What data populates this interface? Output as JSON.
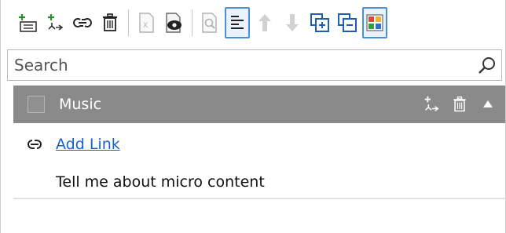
{
  "toolbar": {
    "buttons": [
      {
        "name": "add-item-button",
        "icon": "add-item-icon"
      },
      {
        "name": "add-category-button",
        "icon": "add-category-icon"
      },
      {
        "name": "link-button",
        "icon": "link-icon"
      },
      {
        "name": "delete-button",
        "icon": "trash-icon"
      },
      {
        "name": "export-button",
        "icon": "excel-icon"
      },
      {
        "name": "preview-button",
        "icon": "eye-icon"
      },
      {
        "name": "search-content-button",
        "icon": "magnifier-icon"
      },
      {
        "name": "list-view-button",
        "icon": "list-icon"
      },
      {
        "name": "move-up-button",
        "icon": "arrow-up-icon"
      },
      {
        "name": "move-down-button",
        "icon": "arrow-down-icon"
      },
      {
        "name": "expand-all-button",
        "icon": "expand-all-icon"
      },
      {
        "name": "collapse-all-button",
        "icon": "collapse-all-icon"
      },
      {
        "name": "color-grid-button",
        "icon": "color-grid-icon"
      }
    ]
  },
  "search": {
    "placeholder": "Search",
    "value": ""
  },
  "category": {
    "title": "Music",
    "checked": false
  },
  "items": {
    "add_link_label": "Add Link",
    "content_label": "Tell me about micro content"
  },
  "colors": {
    "category_bg": "#8a8a8a",
    "link": "#1a5fd0",
    "accent": "#4a90d9"
  }
}
